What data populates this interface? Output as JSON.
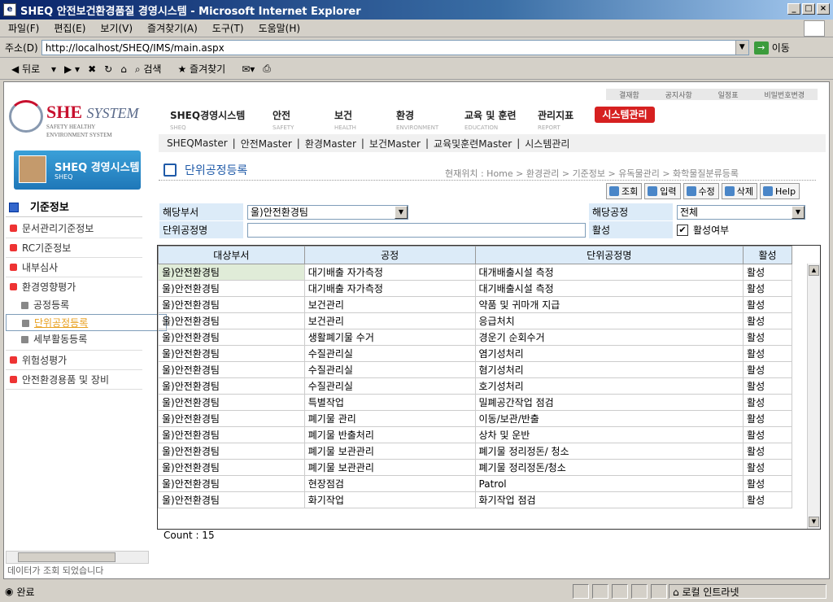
{
  "window": {
    "title": "SHEQ 안전보건환경품질 경영시스템 - Microsoft Internet Explorer"
  },
  "menu": [
    "파일(F)",
    "편집(E)",
    "보기(V)",
    "즐겨찾기(A)",
    "도구(T)",
    "도움말(H)"
  ],
  "address": {
    "label": "주소(D)",
    "url": "http://localhost/SHEQ/IMS/main.aspx",
    "go": "이동"
  },
  "toolbar": {
    "back": "뒤로",
    "search": "검색",
    "favorites": "즐겨찾기"
  },
  "logo": {
    "big": "SHE",
    "big2": "SYSTEM",
    "small1": "SAFETY HEALTHY",
    "small2": "ENVIRONMENT SYSTEM"
  },
  "banner": {
    "title": "SHEQ 경영시스템",
    "sub": "SHEQ"
  },
  "left": {
    "header": "기준정보",
    "items": [
      "문서관리기준정보",
      "RC기준정보",
      "내부심사",
      "환경영향평가",
      "위험성평가",
      "안전환경용품 및 장비"
    ],
    "subs": [
      "공정등록",
      "단위공정등록",
      "세부활동등록"
    ],
    "message": "데이터가 조회 되었습니다"
  },
  "topright": [
    "결재함",
    "공지사항",
    "일정표",
    "비밀번호변경"
  ],
  "topnav": [
    {
      "label": "SHEQ경영시스템",
      "sub": "SHEQ"
    },
    {
      "label": "안전",
      "sub": "SAFETY"
    },
    {
      "label": "보건",
      "sub": "HEALTH"
    },
    {
      "label": "환경",
      "sub": "ENVIRONMENT"
    },
    {
      "label": "교육 및 훈련",
      "sub": "EDUCATION"
    },
    {
      "label": "관리지표",
      "sub": "REPORT"
    }
  ],
  "sysmenu": "시스템관리",
  "subnav": [
    "SHEQMaster",
    "안전Master",
    "환경Master",
    "보건Master",
    "교육및훈련Master",
    "시스템관리"
  ],
  "page": {
    "title": "단위공정등록",
    "breadcrumb": "현재위치 : Home > 환경관리 > 기준정보 > 유독물관리 > 화학물질분류등록"
  },
  "buttons": [
    "조회",
    "입력",
    "수정",
    "삭제",
    "Help"
  ],
  "form": {
    "dept_label": "해당부서",
    "dept_value": "울)안전환경팀",
    "proc_label": "해당공정",
    "proc_value": "전체",
    "name_label": "단위공정명",
    "name_value": "",
    "active_label": "활성",
    "active_check": "활성여부"
  },
  "table": {
    "headers": [
      "대상부서",
      "공정",
      "단위공정명",
      "활성"
    ],
    "rows": [
      [
        "울)안전환경팀",
        "대기배출 자가측정",
        "대개배출시설 측정",
        "활성"
      ],
      [
        "울)안전환경팀",
        "대기배출 자가측정",
        "대기배출시설 측정",
        "활성"
      ],
      [
        "울)안전환경팀",
        "보건관리",
        "약품 및 귀마개 지급",
        "활성"
      ],
      [
        "울)안전환경팀",
        "보건관리",
        "응급처치",
        "활성"
      ],
      [
        "울)안전환경팀",
        "생활폐기물 수거",
        "경운기 순회수거",
        "활성"
      ],
      [
        "울)안전환경팀",
        "수질관리실",
        "염기성처리",
        "활성"
      ],
      [
        "울)안전환경팀",
        "수질관리실",
        "혐기성처리",
        "활성"
      ],
      [
        "울)안전환경팀",
        "수질관리실",
        "호기성처리",
        "활성"
      ],
      [
        "울)안전환경팀",
        "특별작업",
        "밀폐공간작업 점검",
        "활성"
      ],
      [
        "울)안전환경팀",
        "폐기물 관리",
        "이동/보관/반출",
        "활성"
      ],
      [
        "울)안전환경팀",
        "폐기물 반출처리",
        "상차 및 운반",
        "활성"
      ],
      [
        "울)안전환경팀",
        "폐기물 보관관리",
        "폐기물 정리정돈/ 청소",
        "활성"
      ],
      [
        "울)안전환경팀",
        "폐기물 보관관리",
        "폐기물 정리정돈/청소",
        "활성"
      ],
      [
        "울)안전환경팀",
        "현장점검",
        "Patrol",
        "활성"
      ],
      [
        "울)안전환경팀",
        "화기작업",
        "화기작업 점검",
        "활성"
      ]
    ]
  },
  "count": "Count : 15",
  "status": {
    "text": "완료",
    "zone": "로컬 인트라넷"
  }
}
